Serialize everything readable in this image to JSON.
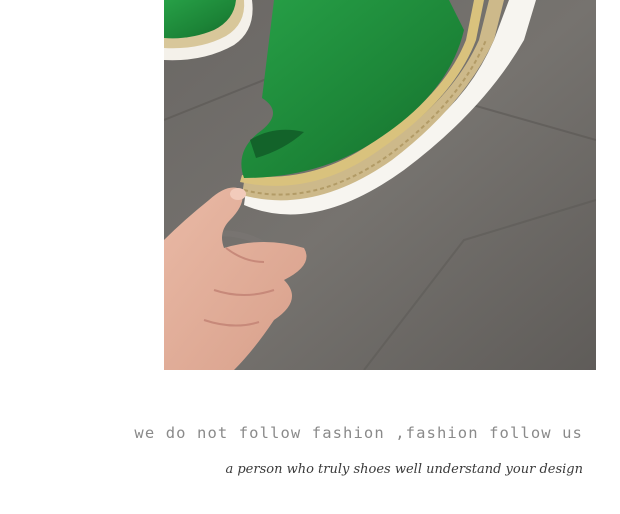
{
  "product_photo": {
    "subject": "green suede peep-toe espadrille wedge sandal held in a hand on a grey stone floor"
  },
  "tagline": "we do not follow fashion ,fashion follow us",
  "subline": "a person who truly shoes well understand your design",
  "colors": {
    "background": "#ffffff",
    "tagline_text": "#8a8a8a",
    "subline_text": "#3a3a3a",
    "shoe_green": "#1f8a3c",
    "floor_grey": "#6f6c69"
  }
}
